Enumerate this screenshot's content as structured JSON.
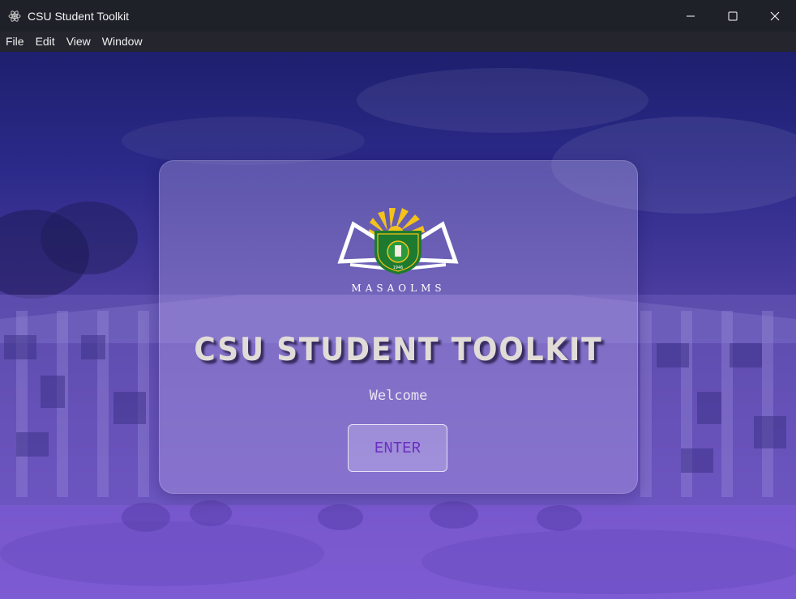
{
  "window": {
    "title": "CSU Student Toolkit",
    "app_icon": "electron-atom-icon",
    "controls": [
      "minimize-icon",
      "maximize-icon",
      "close-icon"
    ]
  },
  "menu": {
    "items": [
      "File",
      "Edit",
      "View",
      "Window"
    ]
  },
  "card": {
    "logo": {
      "caption": "MASAOLMS",
      "badge_year": "1946",
      "icon": "university-seal-logo"
    },
    "heading": "CSU STUDENT TOOLKIT",
    "welcome": "Welcome",
    "enter_label": "ENTER"
  },
  "colors": {
    "titlebar": "#1f2129",
    "menubar": "#24252d",
    "background_top": "#1e1f6e",
    "background_bottom": "#7b57d4",
    "heading": "#e2dcd8",
    "enter_text": "#6a2ec0"
  }
}
